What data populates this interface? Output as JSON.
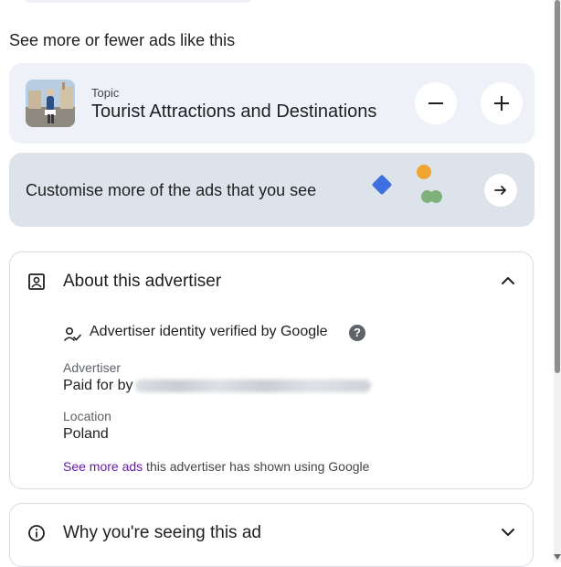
{
  "section_heading": "See more or fewer ads like this",
  "topic_card": {
    "caption": "Topic",
    "name": "Tourist Attractions and Destinations",
    "thumbnail_icon": "topic-photo",
    "minus_icon": "minus-icon",
    "plus_icon": "plus-icon"
  },
  "customise_card": {
    "label": "Customise more of the ads that you see",
    "arrow_icon": "arrow-right-icon"
  },
  "advertiser_card": {
    "title": "About this advertiser",
    "icon": "badge-icon",
    "expanded": true,
    "verified_text": "Advertiser identity verified by Google",
    "help_glyph": "?",
    "advertiser_label": "Advertiser",
    "paid_for_prefix": "Paid for by",
    "location_label": "Location",
    "location_value": "Poland",
    "more_ads_link": "See more ads",
    "more_ads_suffix": " this advertiser has shown using Google"
  },
  "why_card": {
    "title": "Why you're seeing this ad",
    "icon": "info-icon",
    "expanded": false
  },
  "colors": {
    "card_light": "#eef2f8",
    "card_customise": "#dde3ea",
    "link": "#681da8",
    "deco_blue": "#3d6fe0",
    "deco_orange": "#f0a432",
    "deco_green": "#7fb27a"
  }
}
